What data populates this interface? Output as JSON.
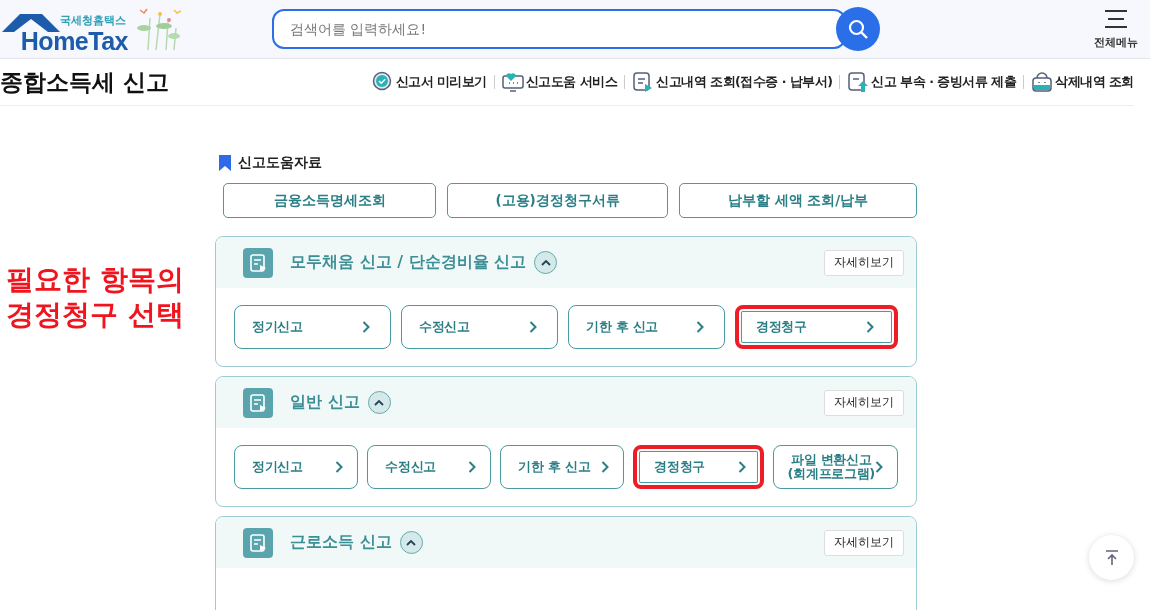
{
  "header": {
    "logo": {
      "subtitle": "국세청홈택스",
      "title": "HomeTax"
    },
    "search": {
      "placeholder": "검색어를 입력하세요!"
    },
    "menu_label": "전체메뉴"
  },
  "page_title": "종합소득세 신고",
  "quick_links": [
    {
      "label": "신고서 미리보기"
    },
    {
      "label": "신고도움 서비스"
    },
    {
      "label": "신고내역 조회(접수증 · 납부서)"
    },
    {
      "label": "신고 부속 · 증빙서류 제출"
    },
    {
      "label": "삭제내역 조회"
    }
  ],
  "help_section": {
    "title": "신고도움자료",
    "buttons": [
      "금융소득명세조회",
      "(고용)경정청구서류",
      "납부할 세액 조회/납부"
    ]
  },
  "sections": [
    {
      "title": "모두채움 신고 / 단순경비율 신고",
      "expanded": true,
      "detail_button": "자세히보기",
      "buttons": [
        {
          "label": "정기신고",
          "highlighted": false
        },
        {
          "label": "수정신고",
          "highlighted": false
        },
        {
          "label": "기한 후 신고",
          "highlighted": false
        },
        {
          "label": "경정청구",
          "highlighted": true
        }
      ]
    },
    {
      "title": "일반 신고",
      "expanded": true,
      "detail_button": "자세히보기",
      "buttons": [
        {
          "label": "정기신고",
          "highlighted": false
        },
        {
          "label": "수정신고",
          "highlighted": false
        },
        {
          "label": "기한 후 신고",
          "highlighted": false
        },
        {
          "label": "경정청구",
          "highlighted": true
        },
        {
          "label": "파일 변환신고\n(회계프로그램)",
          "highlighted": false
        }
      ]
    },
    {
      "title": "근로소득 신고",
      "expanded": true,
      "detail_button": "자세히보기"
    }
  ],
  "annotation": {
    "lines": [
      "필요한 항목의",
      "경정청구 선택"
    ]
  }
}
